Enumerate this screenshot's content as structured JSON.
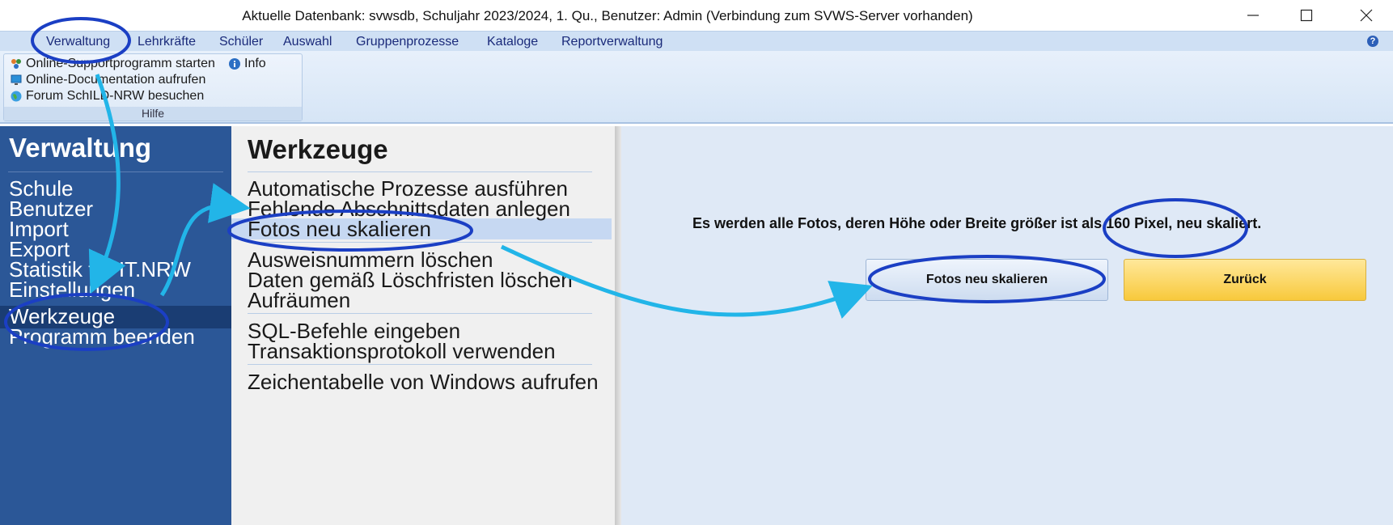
{
  "window": {
    "title": "Aktuelle Datenbank: svwsdb, Schuljahr 2023/2024, 1. Qu., Benutzer: Admin (Verbindung zum SVWS-Server vorhanden)",
    "controls": [
      "minimize-icon",
      "maximize-icon",
      "close-icon"
    ]
  },
  "menubar": {
    "items": [
      "Verwaltung",
      "Lehrkräfte",
      "Schüler",
      "Auswahl",
      "Gruppenprozesse",
      "Kataloge",
      "Reportverwaltung"
    ],
    "help_icon": "?"
  },
  "ribbon": {
    "group_label": "Hilfe",
    "items": [
      {
        "label": "Online-Supportprogramm starten",
        "icon": "support-icon"
      },
      {
        "label": "Info",
        "icon": "info-icon"
      },
      {
        "label": "Online-Documentation aufrufen",
        "icon": "monitor-icon"
      },
      {
        "label": "Forum SchILD-NRW besuchen",
        "icon": "globe-icon"
      }
    ]
  },
  "leftnav": {
    "title": "Verwaltung",
    "items": [
      "Schule",
      "Benutzer",
      "Import",
      "Export",
      "Statistik für IT.NRW",
      "Einstellungen",
      "Werkzeuge",
      "Programm beenden"
    ],
    "selected": "Werkzeuge"
  },
  "tools": {
    "title": "Werkzeuge",
    "items": [
      "Automatische Prozesse ausführen",
      "Fehlende Abschnittsdaten anlegen",
      "Fotos neu skalieren",
      "Ausweisnummern löschen",
      "Daten gemäß Löschfristen löschen",
      "Aufräumen",
      "SQL-Befehle eingeben",
      "Transaktionsprotokoll verwenden",
      "Zeichentabelle von Windows aufrufen"
    ],
    "selected": "Fotos neu skalieren"
  },
  "content": {
    "message": "Es werden alle Fotos, deren Höhe oder Breite größer ist als 160 Pixel, neu skaliert.",
    "primary_button": "Fotos neu skalieren",
    "back_button": "Zurück"
  },
  "colors": {
    "nav_bg": "#2b5797",
    "annotation": "#1b3fc4",
    "arrow": "#22b5e8",
    "back_button": "#f8c93c"
  }
}
